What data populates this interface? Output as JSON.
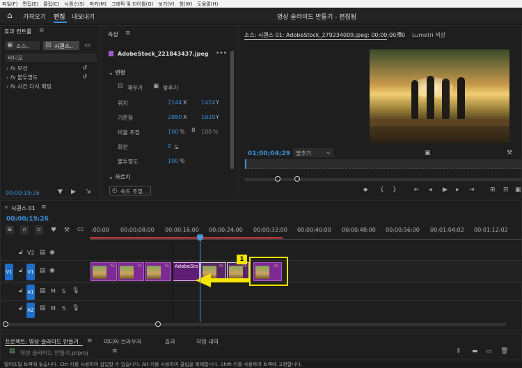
{
  "menu": [
    "파일(F)",
    "편집(E)",
    "클립(C)",
    "시퀀스(S)",
    "마커(M)",
    "그래픽 및 타이틀(G)",
    "보기(V)",
    "창(W)",
    "도움말(H)"
  ],
  "top": {
    "tabs": [
      "가져오기",
      "편집",
      "내보내기"
    ],
    "title": "영상 슬라이드 만들기 - 편집됨"
  },
  "effectControls": {
    "title": "효과 컨트롤",
    "src": "소스..",
    "seq": "시퀀스..",
    "section": "비디오",
    "items": [
      "모션",
      "불투명도",
      "시간 다시 매핑"
    ],
    "time": "00;00;19;26"
  },
  "properties": {
    "title": "속성",
    "file": "AdobeStock_221843437.jpeg",
    "transform": "변형",
    "fill": "채우기",
    "fit": "맞추기",
    "rows": [
      {
        "label": "위치",
        "v1": "2144",
        "u1": "X",
        "v2": "1424",
        "u2": "Y"
      },
      {
        "label": "기준점",
        "v1": "2880",
        "u1": "X",
        "v2": "1920",
        "u2": "Y"
      },
      {
        "label": "비율 조정",
        "v1": "100",
        "u1": "%",
        "v2": "100",
        "u2": "%"
      },
      {
        "label": "회전",
        "v1": "0",
        "u1": "도",
        "v2": "",
        "u2": ""
      },
      {
        "label": "불투명도",
        "v1": "100",
        "u1": "%",
        "v2": "",
        "u2": ""
      }
    ],
    "speedSection": "자르기",
    "speedBtn": "속도 조정..."
  },
  "program": {
    "title": "소스: 시퀀스 01: AdobeStock_279234009.jpeg: 00;00;00;00",
    "lumetri": "Lumetri 색상",
    "time": "01;00;04;29",
    "fit": "맞추기"
  },
  "timeline": {
    "tab": "시퀀스 01",
    "time": "00;00;19;26",
    "ruler": [
      ":00;00",
      "00;00;08;00",
      "00;00;16;00",
      "00;00;24;00",
      "00;00;32;00",
      "00;00;40;00",
      "00;00;48;00",
      "00;00;56;00",
      "00;01;04;02",
      "00;01;12;02"
    ],
    "tracks": {
      "v2": "V2",
      "v1": "V1",
      "a1": "A1",
      "a2": "A2",
      "m": "M",
      "s": "S"
    },
    "clipLabel": "AdobeSto",
    "fx": "fx",
    "callout": "1"
  },
  "bottomTabs": [
    "프로젝트: 영상 슬라이드 만들기",
    "미디어 브라우저",
    "효과",
    "작업 내역"
  ],
  "project": {
    "file": "영상 슬라이드 만들기.prproj"
  },
  "status": "떨어뜨릴 트랙에 놓습니다. Ctrl 키를 사용하여 삽입할 수 있습니다. Alt 키를 사용하여 클립을 복제합니다. Shift 키를 사용하여 트랙에 고정합니다.",
  "colors": {
    "accent": "#3d8fd9",
    "clip": "#7d2a95",
    "highlight": "#f5e400"
  }
}
